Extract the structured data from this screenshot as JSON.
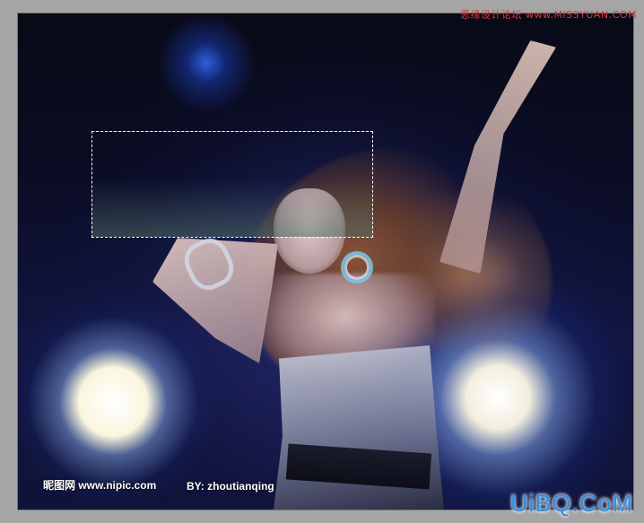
{
  "watermarks": {
    "top_right": "思缘设计论坛 www.MISSYUAN.COM",
    "nipic": "昵图网 www.nipic.com",
    "author": "BY: zhoutianqing",
    "uibq": "UiBQ.CoM"
  },
  "selection": {
    "tool": "rectangular-marquee"
  }
}
